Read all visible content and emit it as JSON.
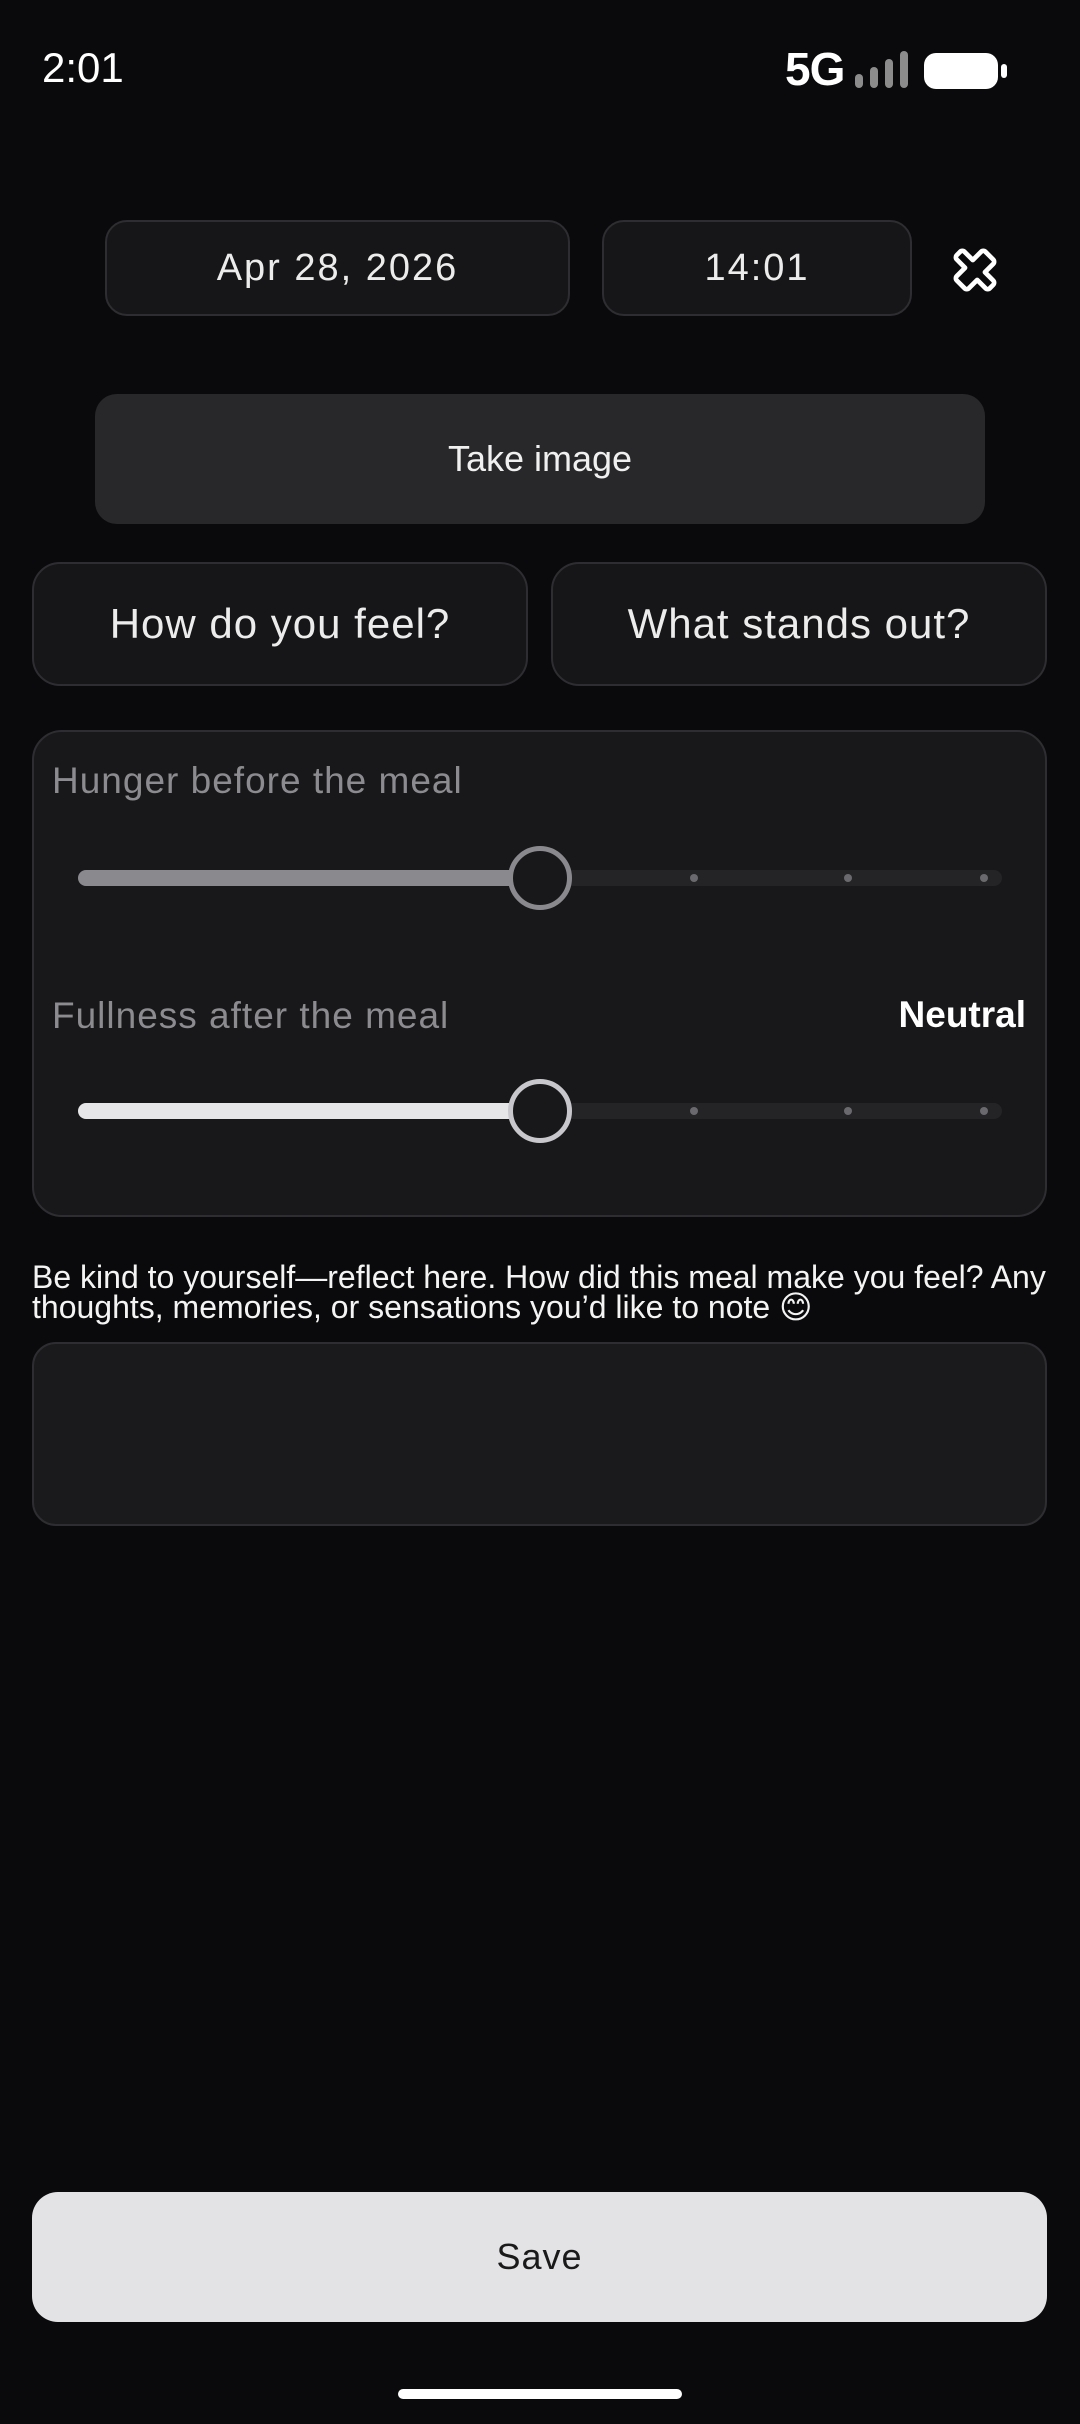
{
  "status_bar": {
    "time": "2:01",
    "network": "5G",
    "signal_icon": "signal-bars-icon",
    "battery_icon": "battery-icon"
  },
  "entry": {
    "date": "Apr 28, 2026",
    "time": "14:01",
    "close_icon": "close-icon"
  },
  "actions": {
    "take_image": "Take image",
    "how_feel": "How do you feel?",
    "stands_out": "What stands out?"
  },
  "sliders": {
    "hunger": {
      "label": "Hunger before the meal",
      "value_fraction": 0.5,
      "steps": 7
    },
    "fullness": {
      "label": "Fullness after the meal",
      "value_label": "Neutral",
      "value_fraction": 0.5,
      "steps": 7
    }
  },
  "reflection": {
    "prompt": "Be kind to yourself—reflect here. How did this meal make you feel? Any thoughts, memories, or sensations you’d like to note 😊",
    "value": ""
  },
  "footer": {
    "save": "Save"
  },
  "colors": {
    "background": "#0a0a0c",
    "card": "#18181a",
    "border": "#2e2e32",
    "save_button": "#e3e3e6",
    "slider_fill_active": "#e6e6e8",
    "slider_fill_dim": "#8a8a8e"
  }
}
